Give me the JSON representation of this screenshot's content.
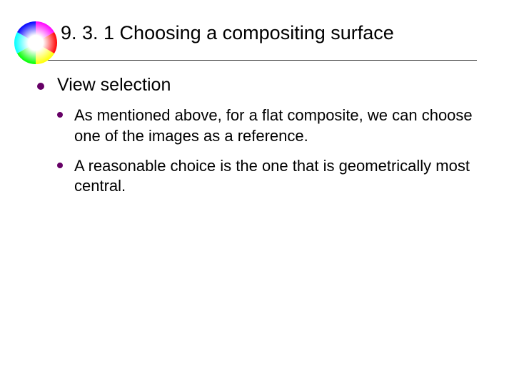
{
  "title": "9. 3. 1 Choosing a compositing surface",
  "bullets": {
    "lvl1": {
      "text": "View selection"
    },
    "lvl2": [
      {
        "text": "As mentioned above, for a flat composite, we can choose one of the images as a reference."
      },
      {
        "text": "A reasonable choice is the one that is geometrically most central."
      }
    ]
  }
}
